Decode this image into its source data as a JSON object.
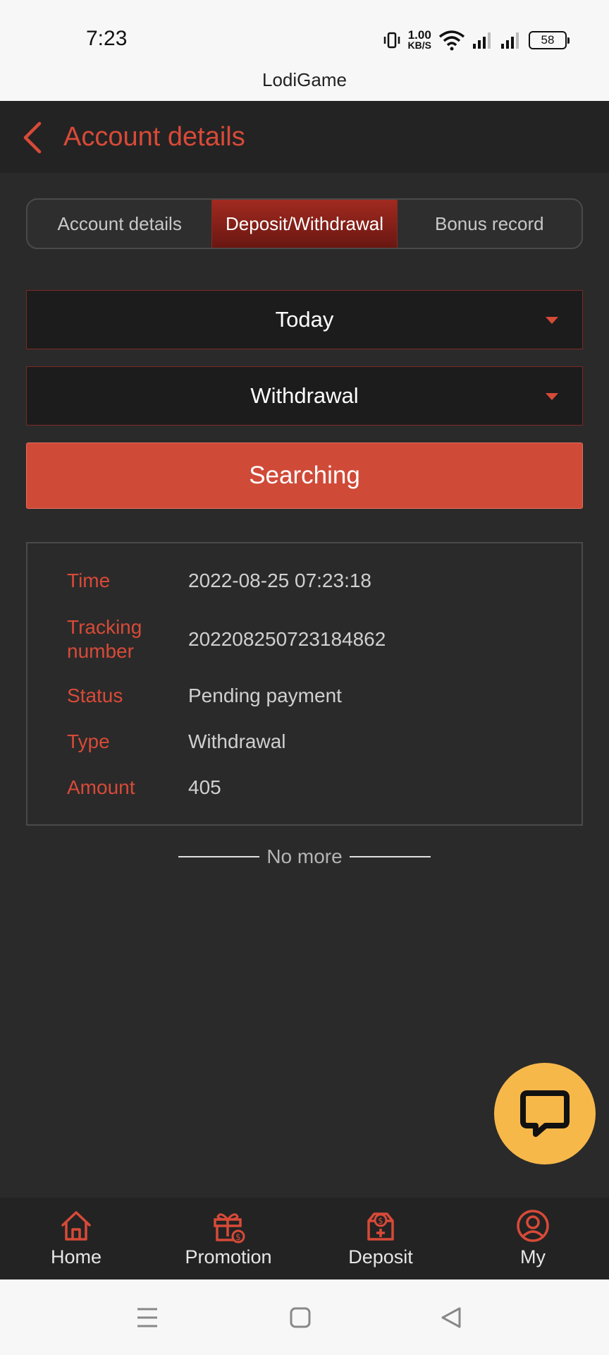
{
  "status_bar": {
    "time": "7:23",
    "net_speed_value": "1.00",
    "net_speed_unit": "KB/S",
    "battery": "58"
  },
  "app": {
    "title": "LodiGame"
  },
  "header": {
    "title": "Account details"
  },
  "tabs": [
    {
      "label": "Account details",
      "active": false
    },
    {
      "label": "Deposit/Withdrawal",
      "active": true
    },
    {
      "label": "Bonus record",
      "active": false
    }
  ],
  "filters": {
    "date_range": "Today",
    "type": "Withdrawal"
  },
  "search_button": "Searching",
  "record": {
    "time_label": "Time",
    "time_value": "2022-08-25 07:23:18",
    "tracking_label_line1": "Tracking",
    "tracking_label_line2": "number",
    "tracking_value": "202208250723184862",
    "status_label": "Status",
    "status_value": "Pending payment",
    "type_label": "Type",
    "type_value": "Withdrawal",
    "amount_label": "Amount",
    "amount_value": "405"
  },
  "list_end_text": "No more",
  "bottom_nav": [
    {
      "label": "Home",
      "icon": "home-icon"
    },
    {
      "label": "Promotion",
      "icon": "gift-icon"
    },
    {
      "label": "Deposit",
      "icon": "deposit-icon"
    },
    {
      "label": "My",
      "icon": "user-icon"
    }
  ],
  "colors": {
    "accent": "#d84a38",
    "chat_button": "#f7b84a",
    "background": "#2a2a2a"
  }
}
